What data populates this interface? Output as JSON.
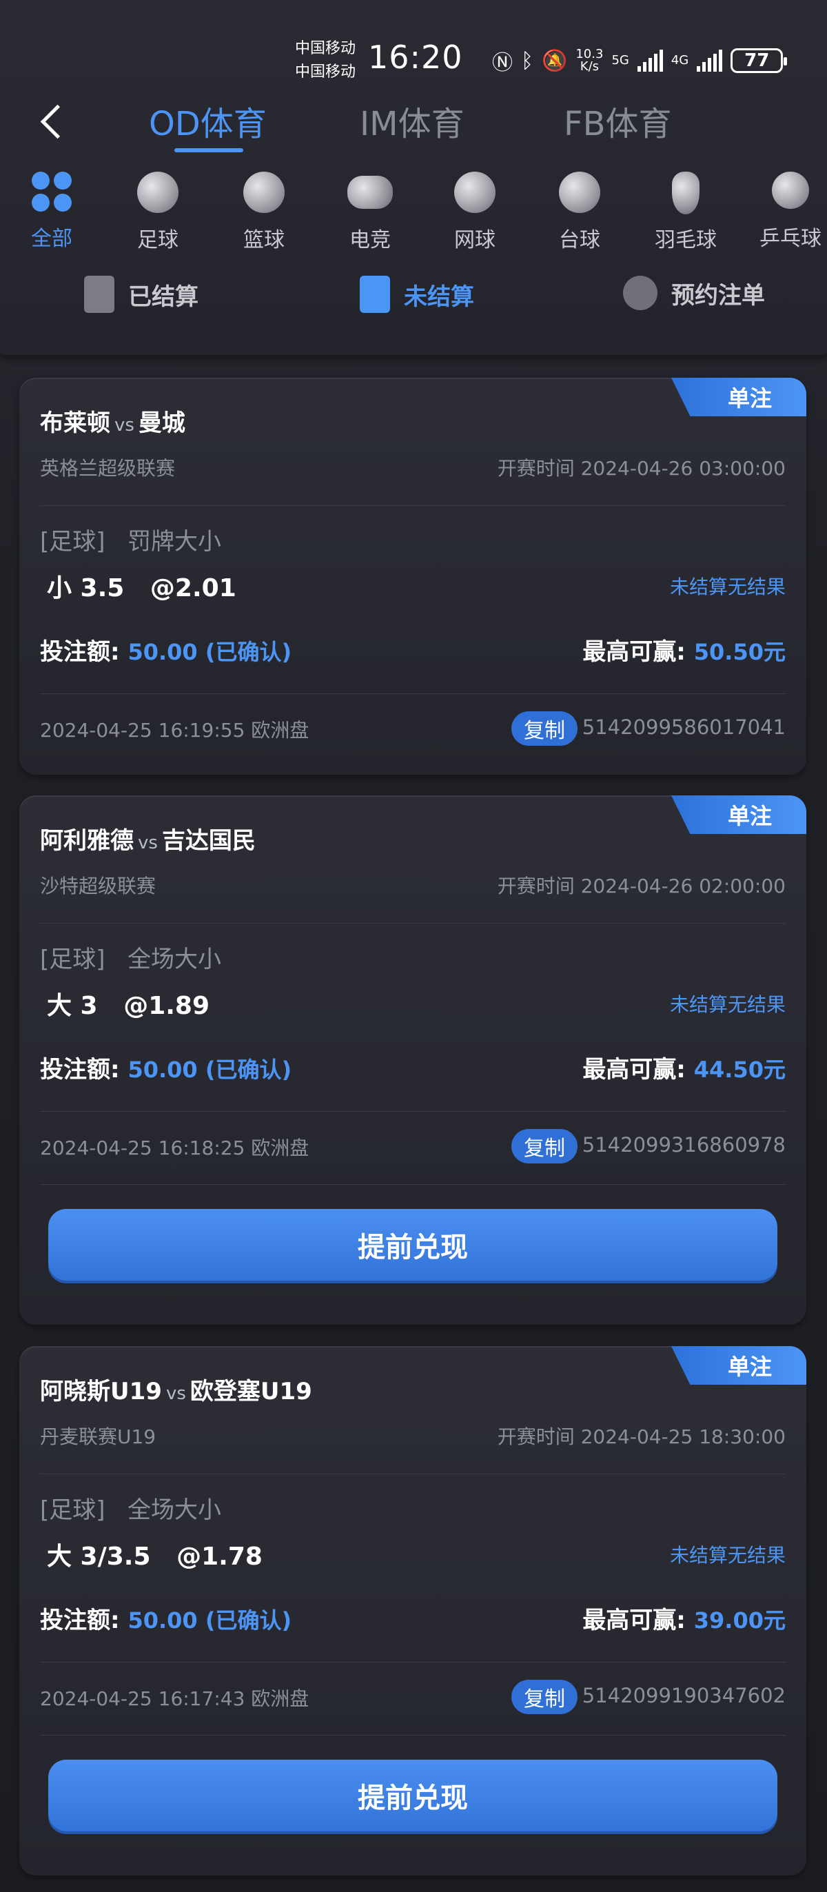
{
  "status_bar": {
    "carrier1": "中国移动",
    "carrier2": "中国移动",
    "time": "16:20",
    "speed_top": "10.3",
    "speed_bottom": "K/s",
    "net1": "5G",
    "net2": "4G",
    "battery": "77"
  },
  "header": {
    "tabs": [
      {
        "label": "OD体育",
        "active": true
      },
      {
        "label": "IM体育",
        "active": false
      },
      {
        "label": "FB体育",
        "active": false
      }
    ]
  },
  "categories": [
    {
      "label": "全部",
      "icon": "grid-icon",
      "active": true
    },
    {
      "label": "足球",
      "icon": "soccer-ball-icon"
    },
    {
      "label": "篮球",
      "icon": "basketball-icon"
    },
    {
      "label": "电竞",
      "icon": "gamepad-icon"
    },
    {
      "label": "网球",
      "icon": "tennis-ball-icon"
    },
    {
      "label": "台球",
      "icon": "billiard-ball-icon"
    },
    {
      "label": "羽毛球",
      "icon": "shuttlecock-icon"
    },
    {
      "label": "乒乓球",
      "icon": "table-tennis-icon"
    }
  ],
  "settle_tabs": [
    {
      "label": "已结算",
      "icon": "settled-doc-icon"
    },
    {
      "label": "未结算",
      "icon": "unsettled-doc-icon",
      "active": true
    },
    {
      "label": "预约注单",
      "icon": "alarm-clock-icon"
    }
  ],
  "labels": {
    "vs": "vs",
    "start_prefix": "开赛时间 ",
    "stake_label": "投注额:",
    "max_win_label": "最高可赢:",
    "unsettled_text": "未结算无结果",
    "copy": "复制",
    "cashout": "提前兑现",
    "badge": "单注"
  },
  "bets": [
    {
      "home": "布莱顿",
      "away": "曼城",
      "league": "英格兰超级联赛",
      "start_time": "2024-04-26 03:00:00",
      "sport": "[足球]",
      "market": "罚牌大小",
      "selection": "小 3.5",
      "odds": "@2.01",
      "stake": "50.00 (已确认)",
      "max_win": "50.50元",
      "placed_at": "2024-04-25 16:19:55 欧洲盘",
      "order_no": "5142099586017041",
      "cashout": false
    },
    {
      "home": "阿利雅德",
      "away": "吉达国民",
      "league": "沙特超级联赛",
      "start_time": "2024-04-26 02:00:00",
      "sport": "[足球]",
      "market": "全场大小",
      "selection": "大 3",
      "odds": "@1.89",
      "stake": "50.00 (已确认)",
      "max_win": "44.50元",
      "placed_at": "2024-04-25 16:18:25 欧洲盘",
      "order_no": "5142099316860978",
      "cashout": true
    },
    {
      "home": "阿晓斯U19",
      "away": "欧登塞U19",
      "league": "丹麦联赛U19",
      "start_time": "2024-04-25 18:30:00",
      "sport": "[足球]",
      "market": "全场大小",
      "selection": "大 3/3.5",
      "odds": "@1.78",
      "stake": "50.00 (已确认)",
      "max_win": "39.00元",
      "placed_at": "2024-04-25 16:17:43 欧洲盘",
      "order_no": "5142099190347602",
      "cashout": true
    }
  ],
  "colors": {
    "accent": "#4d95f5",
    "background": "#1d1e24",
    "card": "#2a2b33",
    "muted_text": "#8d8f98"
  }
}
